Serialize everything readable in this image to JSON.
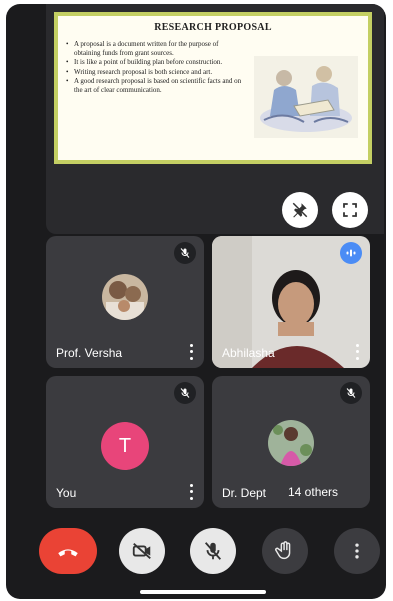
{
  "slide": {
    "title": "RESEARCH PROPOSAL",
    "bullets": [
      "A proposal is a document written for the purpose of obtaining funds from grant sources.",
      "It is like a point of building plan before construction.",
      "Writing research proposal is both science and art.",
      "A good research proposal is based on scientific facts and on the art of clear communication."
    ]
  },
  "participants": [
    {
      "name": "Prof. Versha",
      "muted": true
    },
    {
      "name": "Abhilasha",
      "speaking": true
    },
    {
      "name": "You",
      "avatar_letter": "T",
      "muted": true
    },
    {
      "name": "Dr. Dept",
      "others_label": "14 others",
      "muted": true
    }
  ],
  "colors": {
    "end_call": "#ea4335",
    "speaking": "#4b8cf5",
    "you_avatar": "#e8457a",
    "slide_border": "#c4cf63"
  },
  "icons": {
    "presentation_actions": [
      "pin-off-icon",
      "fullscreen-icon"
    ],
    "controls": [
      "end-call-icon",
      "camera-off-icon",
      "mic-off-icon",
      "raise-hand-icon",
      "more-vert-icon"
    ]
  }
}
